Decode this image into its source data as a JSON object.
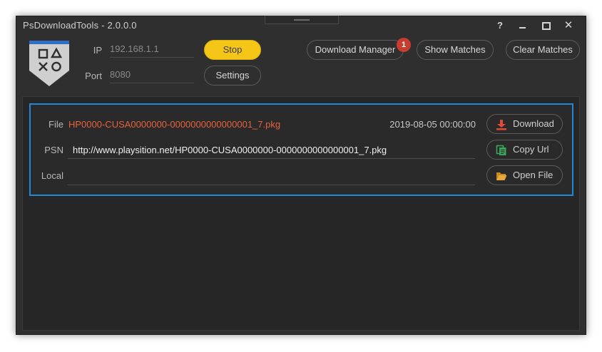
{
  "window": {
    "title": "PsDownloadTools - 2.0.0.0",
    "controls": {
      "help": "?",
      "close": "✕"
    }
  },
  "connection": {
    "ip_label": "IP",
    "ip_value": "192.168.1.1",
    "port_label": "Port",
    "port_value": "8080"
  },
  "toolbar": {
    "stop_label": "Stop",
    "settings_label": "Settings",
    "download_manager_label": "Download Manager",
    "download_manager_badge": "1",
    "show_matches_label": "Show Matches",
    "clear_matches_label": "Clear Matches"
  },
  "match": {
    "file_label": "File",
    "file_value": "HP0000-CUSA0000000-0000000000000001_7.pkg",
    "date_value": "2019-08-05 00:00:00",
    "psn_label": "PSN",
    "psn_value": "http://www.playsition.net/HP0000-CUSA0000000-0000000000000001_7.pkg",
    "local_label": "Local",
    "local_value": "",
    "download_label": "Download",
    "copy_url_label": "Copy Url",
    "open_file_label": "Open File"
  },
  "colors": {
    "accent_yellow": "#f5c518",
    "card_border": "#1f88d8",
    "file_text": "#e8623c",
    "badge": "#c83d2e",
    "download_icon": "#e04a3a",
    "copy_icon": "#3aa55a",
    "open_icon": "#e0a030"
  },
  "icons": {
    "logo": "playstation-symbols-logo",
    "download": "download-arrow-icon",
    "copy": "copy-icon",
    "open": "folder-open-icon"
  }
}
